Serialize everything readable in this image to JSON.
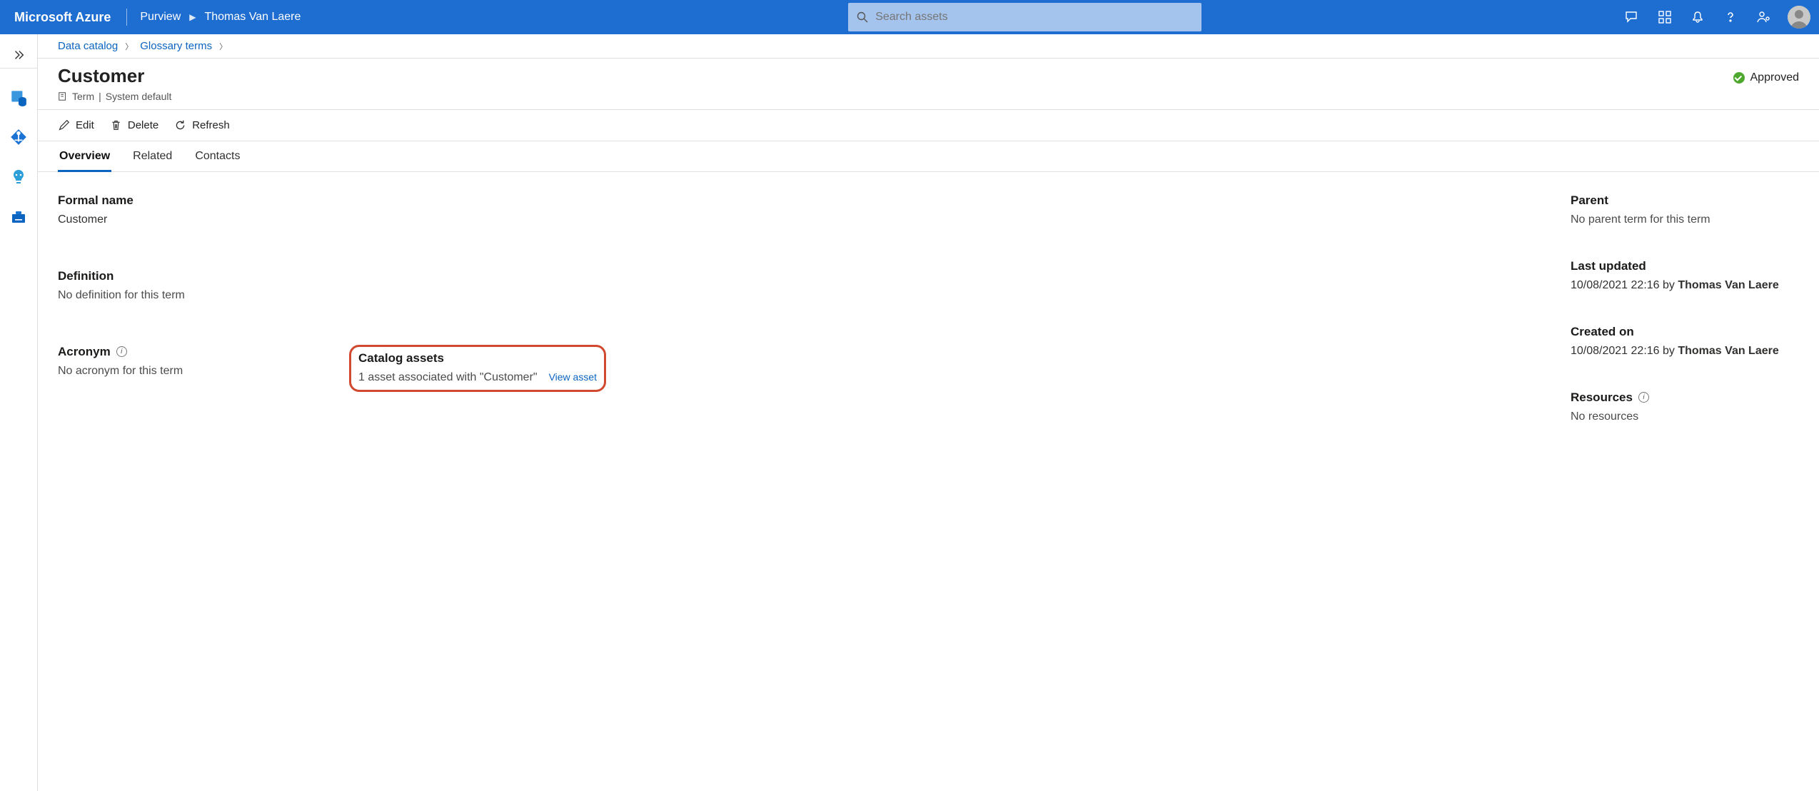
{
  "header": {
    "brand": "Microsoft Azure",
    "crumbs": [
      "Purview",
      "Thomas Van Laere"
    ],
    "search_placeholder": "Search assets"
  },
  "breadcrumb": {
    "items": [
      "Data catalog",
      "Glossary terms"
    ]
  },
  "page": {
    "title": "Customer",
    "subtitle_type": "Term",
    "subtitle_sep": " | ",
    "subtitle_template": "System default",
    "status": "Approved"
  },
  "toolbar": {
    "edit": "Edit",
    "delete": "Delete",
    "refresh": "Refresh"
  },
  "tabs": [
    "Overview",
    "Related",
    "Contacts"
  ],
  "overview": {
    "formal_name_label": "Formal name",
    "formal_name_value": "Customer",
    "definition_label": "Definition",
    "definition_value": "No definition for this term",
    "acronym_label": "Acronym",
    "acronym_value": "No acronym for this term",
    "catalog_assets_label": "Catalog assets",
    "catalog_assets_value": "1 asset associated with \"Customer\"",
    "view_asset": "View asset",
    "parent_label": "Parent",
    "parent_value": "No parent term for this term",
    "last_updated_label": "Last updated",
    "last_updated_value_prefix": "10/08/2021 22:16 by ",
    "last_updated_by": "Thomas Van Laere",
    "created_on_label": "Created on",
    "created_on_value_prefix": "10/08/2021 22:16 by ",
    "created_on_by": "Thomas Van Laere",
    "resources_label": "Resources",
    "resources_value": "No resources"
  }
}
